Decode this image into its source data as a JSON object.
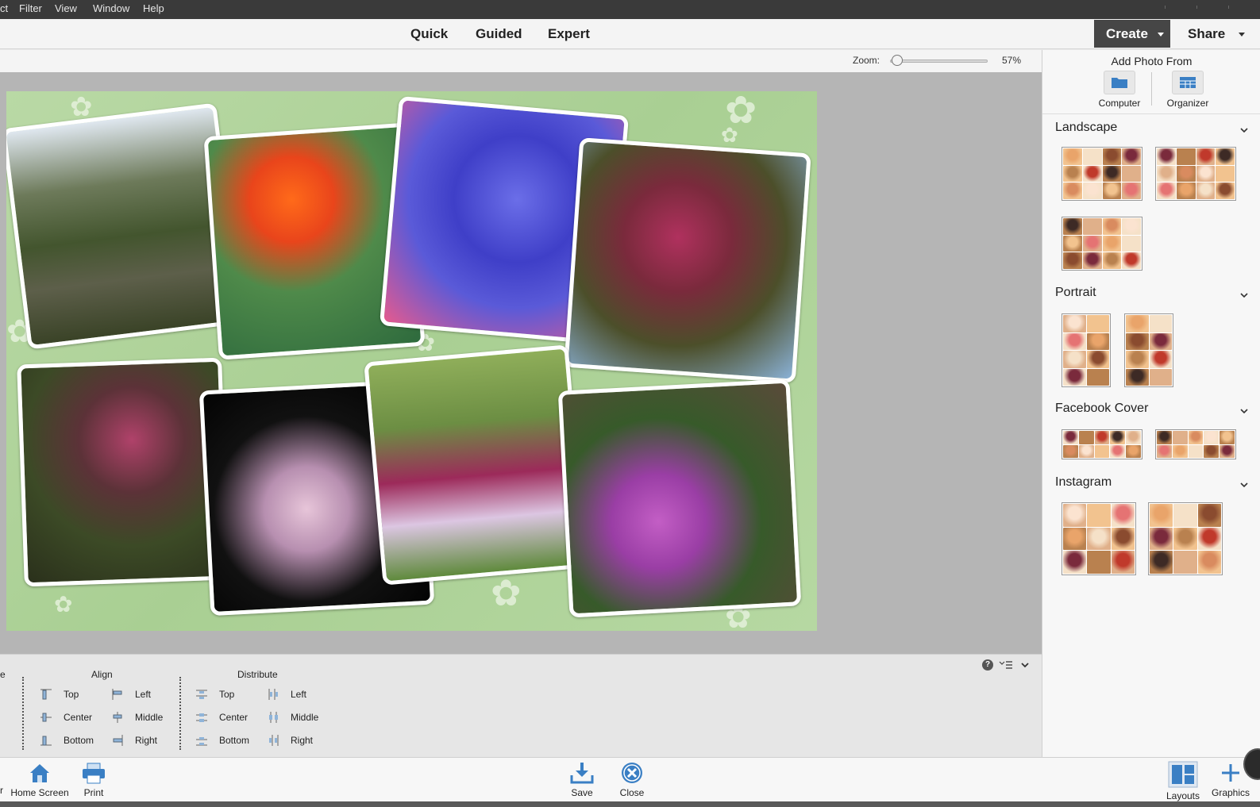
{
  "menu": {
    "items": [
      "ct",
      "Filter",
      "View",
      "Window",
      "Help"
    ]
  },
  "modes": {
    "quick": "Quick",
    "guided": "Guided",
    "expert": "Expert"
  },
  "actions": {
    "create": "Create",
    "share": "Share"
  },
  "zoom": {
    "label": "Zoom:",
    "value": "57%",
    "percent": 57
  },
  "add_photo": {
    "title": "Add Photo From",
    "computer": "Computer",
    "organizer": "Organizer"
  },
  "layouts": {
    "landscape": "Landscape",
    "portrait": "Portrait",
    "facebook": "Facebook Cover",
    "instagram": "Instagram"
  },
  "options": {
    "edge_label": "e",
    "align": {
      "title": "Align",
      "top": "Top",
      "center": "Center",
      "bottom": "Bottom",
      "left": "Left",
      "middle": "Middle",
      "right": "Right"
    },
    "distribute": {
      "title": "Distribute",
      "top": "Top",
      "center": "Center",
      "bottom": "Bottom",
      "left": "Left",
      "middle": "Middle",
      "right": "Right"
    },
    "help": "?"
  },
  "bottom": {
    "home_prefix": "r",
    "home": "Home Screen",
    "print": "Print",
    "save": "Save",
    "close": "Close",
    "layouts": "Layouts",
    "graphics": "Graphics"
  },
  "colors": {
    "accent_blue": "#3a7fc4",
    "create_bg": "#464646",
    "collage_bg": "#b0d49c"
  }
}
